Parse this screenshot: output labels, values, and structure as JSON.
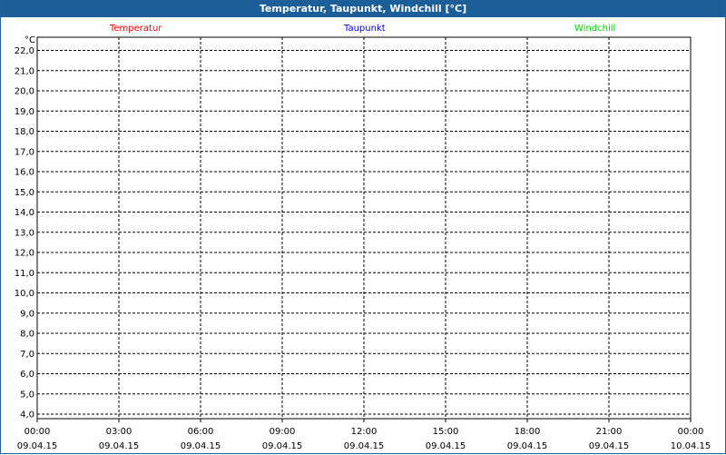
{
  "window": {
    "title": "Temperatur, Taupunkt, Windchill [°C]"
  },
  "chart_data": {
    "type": "line",
    "title": "Temperatur, Taupunkt, Windchill [°C]",
    "ylabel": "°C",
    "ylim": [
      4.0,
      22.0
    ],
    "y_ticks": [
      4.0,
      5.0,
      6.0,
      7.0,
      8.0,
      9.0,
      10.0,
      11.0,
      12.0,
      13.0,
      14.0,
      15.0,
      16.0,
      17.0,
      18.0,
      19.0,
      20.0,
      21.0,
      22.0
    ],
    "y_tick_labels": [
      "4,0",
      "5,0",
      "6,0",
      "7,0",
      "8,0",
      "9,0",
      "10,0",
      "11,0",
      "12,0",
      "13,0",
      "14,0",
      "15,0",
      "16,0",
      "17,0",
      "18,0",
      "19,0",
      "20,0",
      "21,0",
      "22,0"
    ],
    "x_ticks": [
      {
        "time": "00:00",
        "date": "09.04.15"
      },
      {
        "time": "03:00",
        "date": "09.04.15"
      },
      {
        "time": "06:00",
        "date": "09.04.15"
      },
      {
        "time": "09:00",
        "date": "09.04.15"
      },
      {
        "time": "12:00",
        "date": "09.04.15"
      },
      {
        "time": "15:00",
        "date": "09.04.15"
      },
      {
        "time": "18:00",
        "date": "09.04.15"
      },
      {
        "time": "21:00",
        "date": "09.04.15"
      },
      {
        "time": "00:00",
        "date": "10.04.15"
      }
    ],
    "grid": true,
    "legend_position": "top",
    "series": [
      {
        "name": "Temperatur",
        "color": "#ff0000",
        "values": []
      },
      {
        "name": "Taupunkt",
        "color": "#0000ff",
        "values": []
      },
      {
        "name": "Windchill",
        "color": "#00cc00",
        "values": []
      }
    ]
  }
}
